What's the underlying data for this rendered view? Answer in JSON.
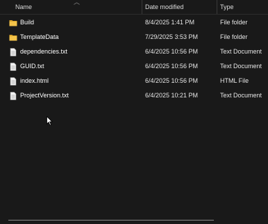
{
  "columns": {
    "name": "Name",
    "date": "Date modified",
    "type": "Type"
  },
  "files": [
    {
      "name": "Build",
      "date": "8/4/2025 1:41 PM",
      "type": "File folder",
      "icon": "folder-icon"
    },
    {
      "name": "TemplateData",
      "date": "7/29/2025 3:53 PM",
      "type": "File folder",
      "icon": "folder-icon"
    },
    {
      "name": "dependencies.txt",
      "date": "6/4/2025 10:56 PM",
      "type": "Text Document",
      "icon": "text-file-icon"
    },
    {
      "name": "GUID.txt",
      "date": "6/4/2025 10:56 PM",
      "type": "Text Document",
      "icon": "text-file-icon"
    },
    {
      "name": "index.html",
      "date": "6/4/2025 10:56 PM",
      "type": "HTML File",
      "icon": "html-file-icon"
    },
    {
      "name": "ProjectVersion.txt",
      "date": "6/4/2025 10:21 PM",
      "type": "Text Document",
      "icon": "text-file-icon"
    }
  ],
  "colors": {
    "background": "#191919",
    "folder": "#f3c34a",
    "text": "#ffffff"
  }
}
